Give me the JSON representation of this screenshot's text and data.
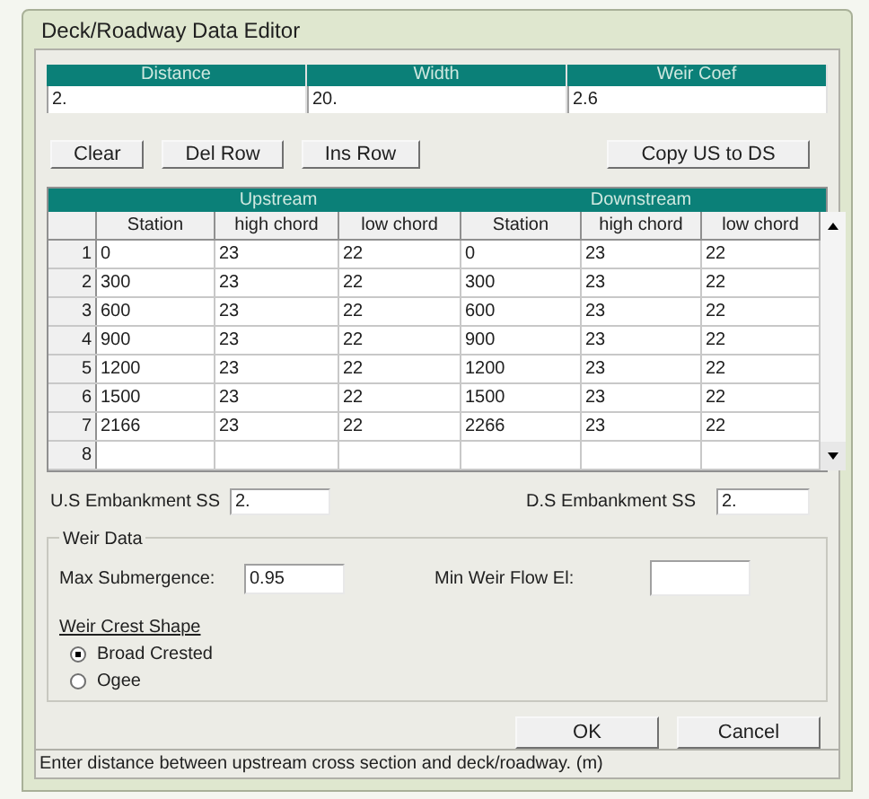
{
  "window": {
    "title": "Deck/Roadway Data Editor"
  },
  "top_fields": [
    {
      "label": "Distance",
      "value": "2."
    },
    {
      "label": "Width",
      "value": "20."
    },
    {
      "label": "Weir Coef",
      "value": "2.6"
    }
  ],
  "row_buttons": [
    "Clear",
    "Del Row",
    "Ins Row"
  ],
  "copy_button": "Copy US to DS",
  "table": {
    "groups": [
      "Upstream",
      "Downstream"
    ],
    "columns": [
      "Station",
      "high chord",
      "low chord",
      "Station",
      "high chord",
      "low chord"
    ],
    "rows": [
      {
        "number": "1",
        "cells": [
          "0",
          "23",
          "22",
          "0",
          "23",
          "22"
        ]
      },
      {
        "number": "2",
        "cells": [
          "300",
          "23",
          "22",
          "300",
          "23",
          "22"
        ]
      },
      {
        "number": "3",
        "cells": [
          "600",
          "23",
          "22",
          "600",
          "23",
          "22"
        ]
      },
      {
        "number": "4",
        "cells": [
          "900",
          "23",
          "22",
          "900",
          "23",
          "22"
        ]
      },
      {
        "number": "5",
        "cells": [
          "1200",
          "23",
          "22",
          "1200",
          "23",
          "22"
        ]
      },
      {
        "number": "6",
        "cells": [
          "1500",
          "23",
          "22",
          "1500",
          "23",
          "22"
        ]
      },
      {
        "number": "7",
        "cells": [
          "2166",
          "23",
          "22",
          "2266",
          "23",
          "22"
        ]
      },
      {
        "number": "8"
      }
    ]
  },
  "embankment": [
    {
      "label": "U.S Embankment SS",
      "value": "2."
    },
    {
      "label": "D.S Embankment SS",
      "value": "2."
    }
  ],
  "weir_data": {
    "title": "Weir Data",
    "max_submergence": {
      "label": "Max  Submergence:",
      "value": "0.95"
    },
    "min_weir_flow": {
      "label": "Min Weir Flow El:"
    },
    "crest_shape": {
      "label": "Weir Crest Shape",
      "options": [
        {
          "label": "Broad Crested",
          "selected": true
        },
        {
          "label": "Ogee",
          "selected": false
        }
      ]
    }
  },
  "dialog_buttons": [
    "OK",
    "Cancel"
  ],
  "status_bar": "Enter distance between upstream cross section and deck/roadway. (m)"
}
